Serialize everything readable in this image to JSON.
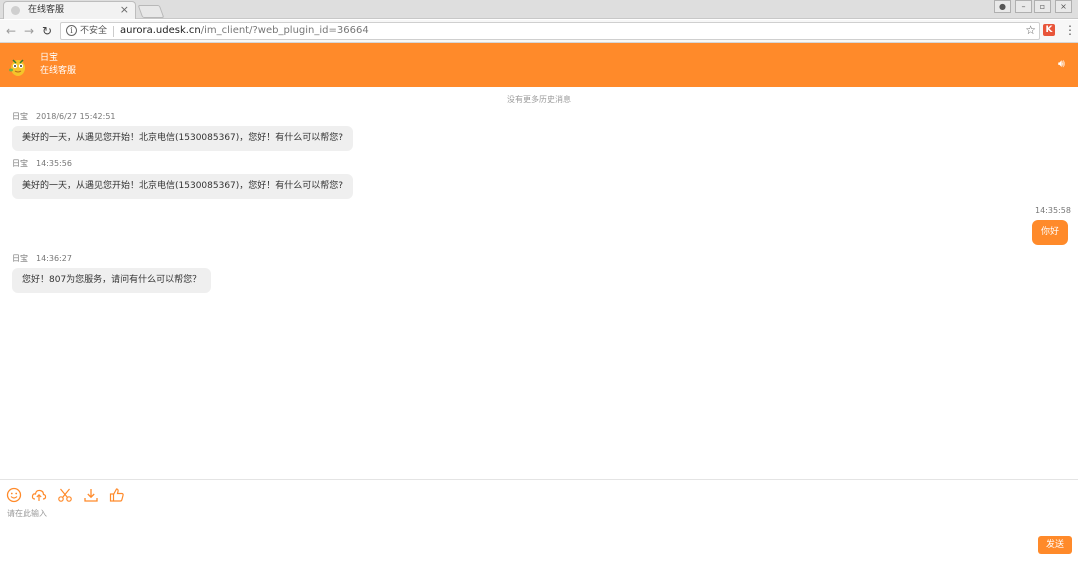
{
  "browser": {
    "tab_title": "在线客服",
    "tab_close": "×",
    "security_label": "不安全",
    "url_host": "aurora.udesk.cn",
    "url_path": "/im_client/?web_plugin_id=36664",
    "extension_label": "K"
  },
  "header": {
    "agent_name": "日宝",
    "agent_role": "在线客服",
    "background": "#ff8a2a"
  },
  "chat": {
    "history_notice": "没有更多历史消息",
    "messages": [
      {
        "sender": "日宝",
        "time": "2018/6/27 15:42:51",
        "text": "美好的一天，从遇见您开始！北京电信(1530085367)，您好！有什么可以帮您?"
      },
      {
        "sender": "日宝",
        "time": "14:35:56",
        "text": "美好的一天，从遇见您开始！北京电信(1530085367)，您好！有什么可以帮您?"
      },
      {
        "sender": "",
        "time": "14:35:58",
        "text": "你好"
      },
      {
        "sender": "日宝",
        "time": "14:36:27",
        "text": "您好！807为您服务，请问有什么可以帮您？"
      }
    ]
  },
  "composer": {
    "tools": [
      "smiley-icon",
      "upload-cloud-icon",
      "scissors-icon",
      "download-icon",
      "thumbs-up-icon"
    ],
    "placeholder": "请在此输入",
    "send_label": "发送"
  },
  "colors": {
    "accent": "#ff8a2a",
    "bubble": "#efefef"
  }
}
